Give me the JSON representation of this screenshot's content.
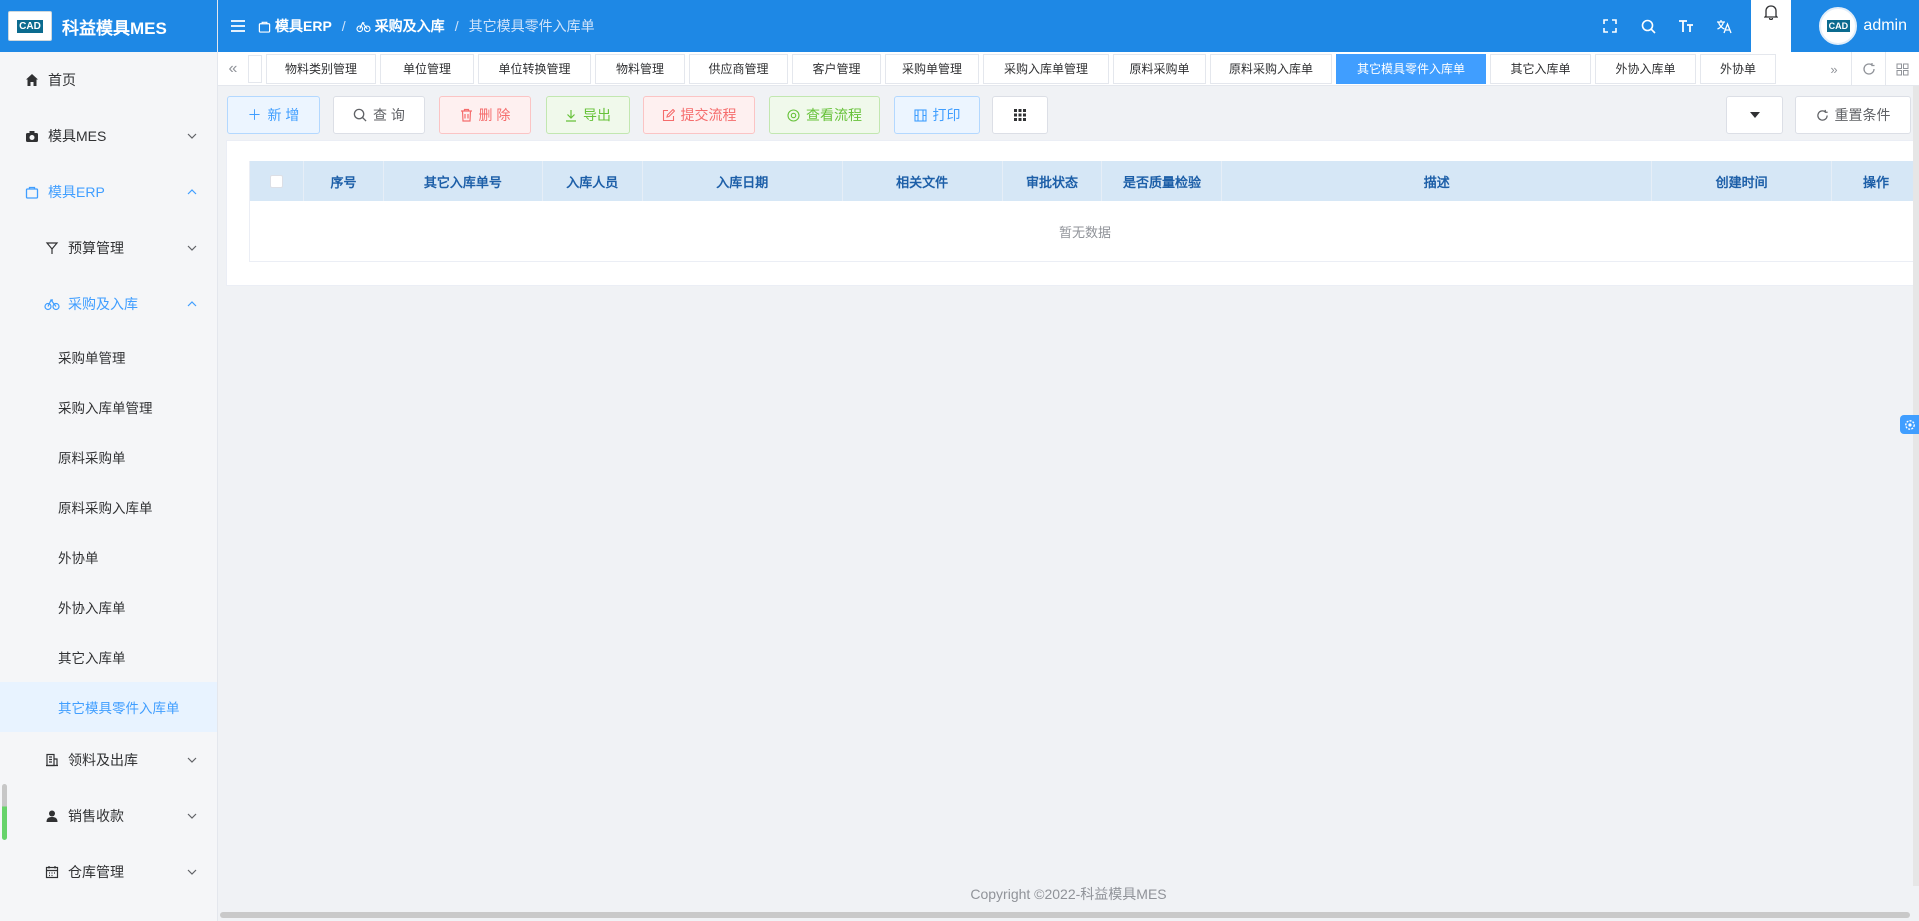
{
  "app": {
    "title": "科益模具MES",
    "logo_text": "CAD"
  },
  "sidebar": {
    "home": "首页",
    "mes": "模具MES",
    "erp": "模具ERP",
    "budget": "预算管理",
    "purchase": "采购及入库",
    "leaves": [
      "采购单管理",
      "采购入库单管理",
      "原料采购单",
      "原料采购入库单",
      "外协单",
      "外协入库单",
      "其它入库单",
      "其它模具零件入库单"
    ],
    "material_out": "领料及出库",
    "sales": "销售收款",
    "warehouse": "仓库管理"
  },
  "header": {
    "breadcrumb": [
      "模具ERP",
      "采购及入库",
      "其它模具零件入库单"
    ],
    "user": "admin"
  },
  "tabs": [
    "物料类别管理",
    "单位管理",
    "单位转换管理",
    "物料管理",
    "供应商管理",
    "客户管理",
    "采购单管理",
    "采购入库单管理",
    "原料采购单",
    "原料采购入库单",
    "其它模具零件入库单",
    "其它入库单",
    "外协入库单",
    "外协单"
  ],
  "active_tab_index": 10,
  "toolbar": {
    "add": "新 增",
    "query": "查 询",
    "delete": "删 除",
    "export": "导出",
    "submit": "提交流程",
    "view": "查看流程",
    "print": "打印",
    "reset": "重置条件"
  },
  "table": {
    "columns": [
      "序号",
      "其它入库单号",
      "入库人员",
      "入库日期",
      "相关文件",
      "审批状态",
      "是否质量检验",
      "描述",
      "创建时间",
      "操作"
    ],
    "empty_text": "暂无数据"
  },
  "footer": "Copyright ©2022-科益模具MES",
  "colors": {
    "primary": "#1e88e5",
    "accent": "#409eff",
    "danger": "#f56c6c",
    "success": "#67c23a"
  }
}
